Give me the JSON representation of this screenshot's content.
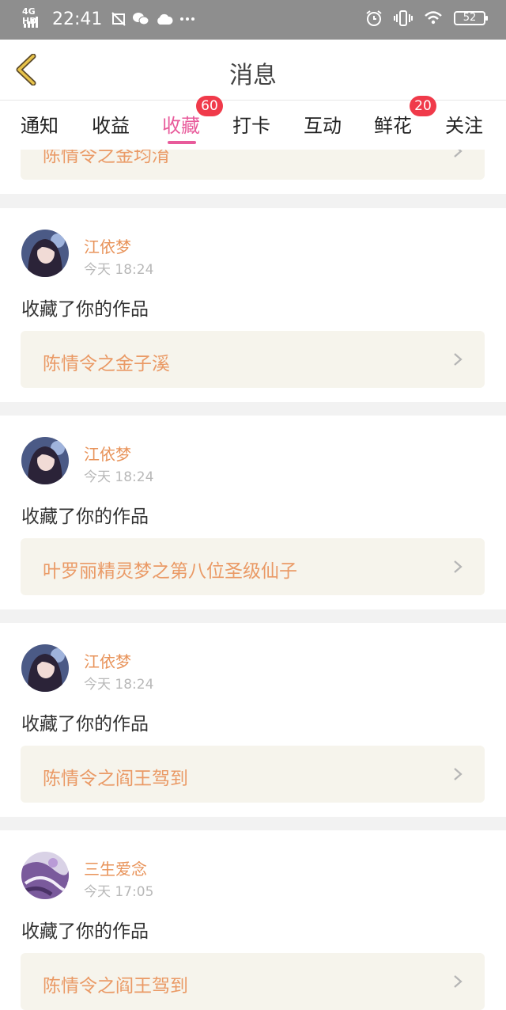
{
  "status_bar": {
    "network": "4G HD",
    "time": "22:41",
    "battery": "52"
  },
  "header": {
    "title": "消息"
  },
  "tabs": [
    {
      "label": "通知"
    },
    {
      "label": "收益"
    },
    {
      "label": "收藏",
      "badge": "60",
      "active": true
    },
    {
      "label": "打卡"
    },
    {
      "label": "互动"
    },
    {
      "label": "鲜花",
      "badge": "20"
    },
    {
      "label": "关注"
    }
  ],
  "colors": {
    "accent": "#e85b9b",
    "badge": "#f03a4a",
    "name": "#e8935a",
    "work": "#ea9a66"
  },
  "feed": {
    "partial_work": "陈情令之金均淯",
    "items": [
      {
        "user": "江依梦",
        "time": "今天 18:24",
        "action": "收藏了你的作品",
        "work": "陈情令之金子溪",
        "avatar": "anime-girl"
      },
      {
        "user": "江依梦",
        "time": "今天 18:24",
        "action": "收藏了你的作品",
        "work": "叶罗丽精灵梦之第八位圣级仙子",
        "avatar": "anime-girl"
      },
      {
        "user": "江依梦",
        "time": "今天 18:24",
        "action": "收藏了你的作品",
        "work": "陈情令之阎王驾到",
        "avatar": "anime-girl"
      },
      {
        "user": "三生爱念",
        "time": "今天 17:05",
        "action": "收藏了你的作品",
        "work": "陈情令之阎王驾到",
        "avatar": "purple-art"
      }
    ]
  }
}
